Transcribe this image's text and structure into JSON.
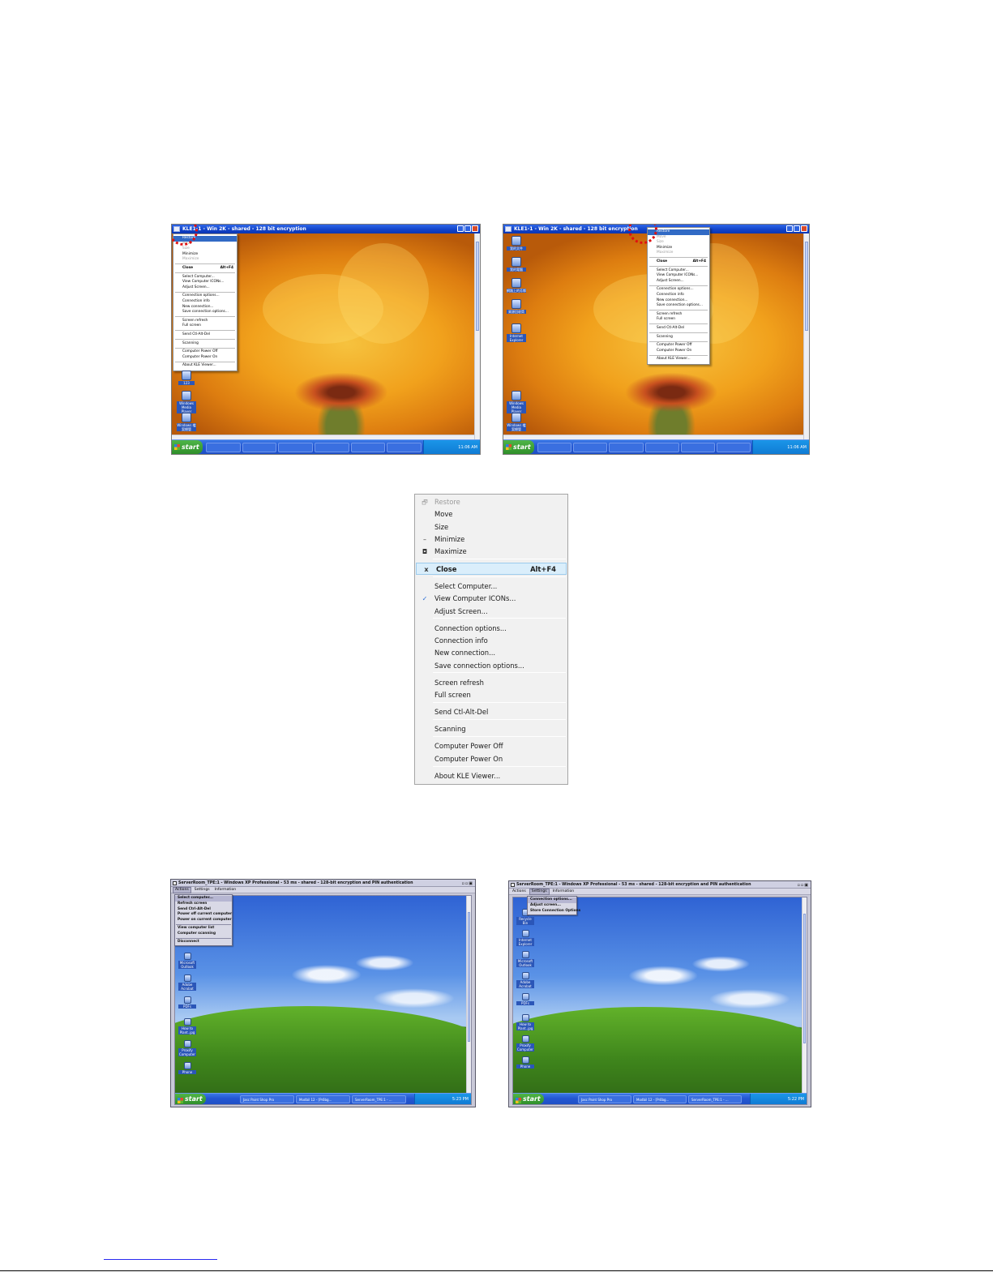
{
  "screenshot_tl": {
    "title": "KLE1-1 - Win 2K - shared - 128 bit encryption",
    "tray_time": "11:06 AM",
    "menu": [
      {
        "label": "Restore",
        "state": "highlighted"
      },
      {
        "label": "Move",
        "state": "disabled"
      },
      {
        "label": "Size",
        "state": "disabled"
      },
      {
        "label": "Minimize",
        "state": "normal"
      },
      {
        "label": "Maximize",
        "state": "disabled"
      },
      {
        "sep": true
      },
      {
        "label": "Close",
        "shortcut": "Alt+F4",
        "state": "bold"
      },
      {
        "sep": true
      },
      {
        "label": "Select Computer...",
        "state": "normal"
      },
      {
        "label": "View Computer ICONs...",
        "state": "normal"
      },
      {
        "label": "Adjust Screen...",
        "state": "normal"
      },
      {
        "sep": true
      },
      {
        "label": "Connection options...",
        "state": "normal"
      },
      {
        "label": "Connection info",
        "state": "normal"
      },
      {
        "label": "New connection...",
        "state": "normal"
      },
      {
        "label": "Save connection options...",
        "state": "normal"
      },
      {
        "sep": true
      },
      {
        "label": "Screen refresh",
        "state": "normal"
      },
      {
        "label": "Full screen",
        "state": "normal"
      },
      {
        "sep": true
      },
      {
        "label": "Send Ctl-Alt-Del",
        "state": "normal"
      },
      {
        "sep": true
      },
      {
        "label": "Scanning",
        "state": "normal"
      },
      {
        "sep": true
      },
      {
        "label": "Computer Power Off",
        "state": "normal"
      },
      {
        "label": "Computer Power On",
        "state": "normal"
      },
      {
        "sep": true
      },
      {
        "label": "About KLE Viewer...",
        "state": "normal"
      }
    ],
    "desktop_icons": [
      "Windows Media Player",
      "Windows 檔案總管"
    ]
  },
  "screenshot_tr": {
    "title": "KLE1-1 - Win 2K - shared - 128 bit encryption",
    "tray_time": "11:06 AM",
    "menu": [
      {
        "label": "Restore",
        "state": "highlighted"
      },
      {
        "label": "Move",
        "state": "disabled"
      },
      {
        "label": "Size",
        "state": "disabled"
      },
      {
        "label": "Minimize",
        "state": "normal"
      },
      {
        "label": "Maximize",
        "state": "disabled"
      },
      {
        "sep": true
      },
      {
        "label": "Close",
        "shortcut": "Alt+F4",
        "state": "bold"
      },
      {
        "sep": true
      },
      {
        "label": "Select Computer...",
        "state": "normal"
      },
      {
        "label": "View Computer ICONs...",
        "state": "normal"
      },
      {
        "label": "Adjust Screen...",
        "state": "normal"
      },
      {
        "sep": true
      },
      {
        "label": "Connection options...",
        "state": "normal"
      },
      {
        "label": "Connection info",
        "state": "normal"
      },
      {
        "label": "New connection...",
        "state": "normal"
      },
      {
        "label": "Save connection options...",
        "state": "normal"
      },
      {
        "sep": true
      },
      {
        "label": "Screen refresh",
        "state": "normal"
      },
      {
        "label": "Full screen",
        "state": "normal"
      },
      {
        "sep": true
      },
      {
        "label": "Send Ctl-Alt-Del",
        "state": "normal"
      },
      {
        "sep": true
      },
      {
        "label": "Scanning",
        "state": "normal"
      },
      {
        "sep": true
      },
      {
        "label": "Computer Power Off",
        "state": "normal"
      },
      {
        "label": "Computer Power On",
        "state": "normal"
      },
      {
        "sep": true
      },
      {
        "label": "About KLE Viewer...",
        "state": "normal"
      }
    ],
    "desktop_icons": [
      "我的文件",
      "我的電腦",
      "網路上的芳鄰",
      "資源回收筒",
      "Internet Explorer",
      "Windows Media Player",
      "Windows 檔案總管"
    ]
  },
  "big_menu": {
    "items": [
      {
        "label": "Restore",
        "state": "disabled",
        "glyph": "🗗"
      },
      {
        "label": "Move",
        "state": "normal",
        "glyph": ""
      },
      {
        "label": "Size",
        "state": "normal",
        "glyph": ""
      },
      {
        "label": "Minimize",
        "state": "normal",
        "glyph": "–"
      },
      {
        "label": "Maximize",
        "state": "normal",
        "glyph": "◘"
      },
      {
        "label": "Close",
        "state": "highlighted",
        "glyph": "x",
        "shortcut": "Alt+F4"
      },
      {
        "label": "Select Computer...",
        "state": "normal",
        "glyph": ""
      },
      {
        "label": "View Computer ICONs...",
        "state": "normal",
        "glyph": "✓"
      },
      {
        "label": "Adjust Screen...",
        "state": "normal",
        "glyph": ""
      },
      {
        "label": "Connection options...",
        "state": "normal",
        "glyph": ""
      },
      {
        "label": "Connection info",
        "state": "normal",
        "glyph": ""
      },
      {
        "label": "New connection...",
        "state": "normal",
        "glyph": ""
      },
      {
        "label": "Save connection options...",
        "state": "normal",
        "glyph": ""
      },
      {
        "label": "Screen refresh",
        "state": "normal",
        "glyph": ""
      },
      {
        "label": "Full screen",
        "state": "normal",
        "glyph": ""
      },
      {
        "label": "Send Ctl-Alt-Del",
        "state": "normal",
        "glyph": ""
      },
      {
        "label": "Scanning",
        "state": "normal",
        "glyph": ""
      },
      {
        "label": "Computer Power Off",
        "state": "normal",
        "glyph": ""
      },
      {
        "label": "Computer Power On",
        "state": "normal",
        "glyph": ""
      },
      {
        "label": "About KLE Viewer...",
        "state": "normal",
        "glyph": ""
      }
    ]
  },
  "screenshot_bl": {
    "title": "ServerRoom_TPE:1 - Windows XP Professional - 53 ms - shared - 128-bit encryption and PIN authentication",
    "menubar": [
      "Actions",
      "Settings",
      "Information"
    ],
    "active_menu": "Actions",
    "menu": [
      {
        "label": "Select computer..."
      },
      {
        "label": "Refresh screen"
      },
      {
        "label": "Send Ctrl-Alt-Del"
      },
      {
        "label": "Power off current computer"
      },
      {
        "label": "Power on current computer"
      },
      {
        "sep": true
      },
      {
        "label": "View computer list"
      },
      {
        "label": "Computer scanning"
      },
      {
        "sep": true
      },
      {
        "label": "Disconnect"
      }
    ],
    "taskbar_items": [
      "Jasc Paint Shop Pro",
      "Modbil 12 - [Prôbg...",
      "ServerRoom_TPE:1 - ..."
    ],
    "tray_time": "5:23 PM",
    "desktop_icons": [
      "Microsoft Outlook",
      "Adobe Acrobat",
      "PDFs",
      "How to Plant..jpg",
      "Proxify Computer",
      "Phone"
    ]
  },
  "screenshot_br": {
    "title": "ServerRoom_TPE:1 - Windows XP Professional - 53 ms - shared - 128-bit encryption and PIN authentication",
    "menubar": [
      "Actions",
      "Settings",
      "Information"
    ],
    "active_menu": "Settings",
    "menu": [
      {
        "label": "Connection options..."
      },
      {
        "label": "Adjust screen..."
      },
      {
        "label": "Store Connection Options"
      }
    ],
    "taskbar_items": [
      "Jasc Paint Shop Pro",
      "Modbil 12 - [Prôbg...",
      "ServerRoom_TPE:1 - ..."
    ],
    "tray_time": "5:22 PM",
    "desktop_icons": [
      "Recycle Bin",
      "Internet Explorer",
      "Microsoft Outlook",
      "Adobe Acrobat",
      "PDFs",
      "How to Plant..jpg",
      "Proxify Computer",
      "Phone"
    ]
  },
  "colors": {
    "callout": "#e01010",
    "xp_titlebar": "#1142c8",
    "menu_highlight": "#daeefb"
  }
}
